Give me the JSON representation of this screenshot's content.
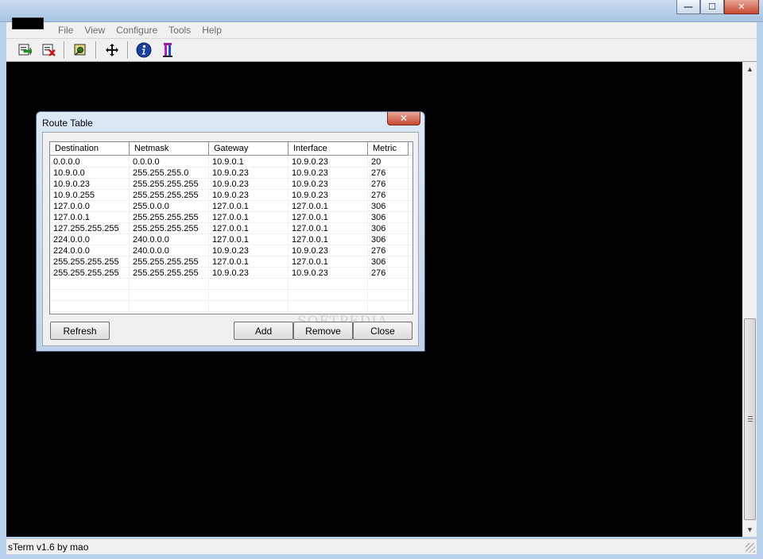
{
  "window": {
    "menu": [
      "File",
      "View",
      "Configure",
      "Tools",
      "Help"
    ],
    "minimize_glyph": "—",
    "maximize_glyph": "☐",
    "close_glyph": "✕"
  },
  "toolbar": {
    "buttons": [
      {
        "icon": "connect-icon"
      },
      {
        "icon": "disconnect-icon"
      },
      {
        "icon": "settings-icon"
      },
      {
        "icon": "move-icon"
      },
      {
        "icon": "info-icon"
      },
      {
        "icon": "about-icon"
      }
    ]
  },
  "status": {
    "text": "sTerm v1.6 by mao"
  },
  "dialog": {
    "title": "Route Table",
    "close_glyph": "✕",
    "columns": [
      "Destination",
      "Netmask",
      "Gateway",
      "Interface",
      "Metric"
    ],
    "rows": [
      [
        "0.0.0.0",
        "0.0.0.0",
        "10.9.0.1",
        "10.9.0.23",
        "20"
      ],
      [
        "10.9.0.0",
        "255.255.255.0",
        "10.9.0.23",
        "10.9.0.23",
        "276"
      ],
      [
        "10.9.0.23",
        "255.255.255.255",
        "10.9.0.23",
        "10.9.0.23",
        "276"
      ],
      [
        "10.9.0.255",
        "255.255.255.255",
        "10.9.0.23",
        "10.9.0.23",
        "276"
      ],
      [
        "127.0.0.0",
        "255.0.0.0",
        "127.0.0.1",
        "127.0.0.1",
        "306"
      ],
      [
        "127.0.0.1",
        "255.255.255.255",
        "127.0.0.1",
        "127.0.0.1",
        "306"
      ],
      [
        "127.255.255.255",
        "255.255.255.255",
        "127.0.0.1",
        "127.0.0.1",
        "306"
      ],
      [
        "224.0.0.0",
        "240.0.0.0",
        "127.0.0.1",
        "127.0.0.1",
        "306"
      ],
      [
        "224.0.0.0",
        "240.0.0.0",
        "10.9.0.23",
        "10.9.0.23",
        "276"
      ],
      [
        "255.255.255.255",
        "255.255.255.255",
        "127.0.0.1",
        "127.0.0.1",
        "306"
      ],
      [
        "255.255.255.255",
        "255.255.255.255",
        "10.9.0.23",
        "10.9.0.23",
        "276"
      ]
    ],
    "buttons": {
      "refresh": "Refresh",
      "add": "Add",
      "remove": "Remove",
      "close": "Close"
    },
    "watermark": "SOFTPEDIA"
  }
}
